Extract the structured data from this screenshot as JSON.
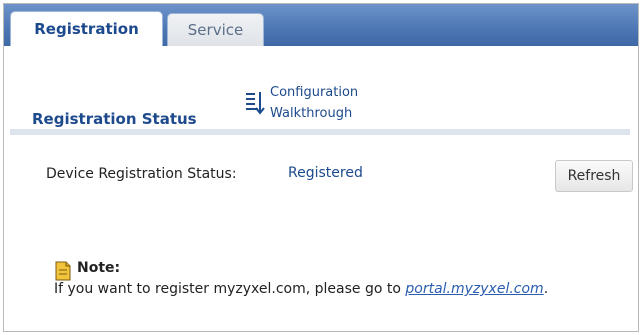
{
  "tabs": [
    {
      "label": "Registration",
      "active": true
    },
    {
      "label": "Service",
      "active": false
    }
  ],
  "walkthrough": {
    "line1": "Configuration",
    "line2": "Walkthrough",
    "icon": "walkthrough-list-icon"
  },
  "section": {
    "title": "Registration Status"
  },
  "status": {
    "label": "Device Registration Status:",
    "value": "Registered",
    "refresh_label": "Refresh"
  },
  "note": {
    "icon": "note-icon",
    "title": "Note:",
    "text_before": "If you want to register myzyxel.com, please go to ",
    "link_text": "portal.myzyxel.com",
    "text_after": "."
  },
  "colors": {
    "tab_bar": "#4f79b6",
    "accent_text": "#1d4a8d",
    "link": "#2a5db0"
  }
}
